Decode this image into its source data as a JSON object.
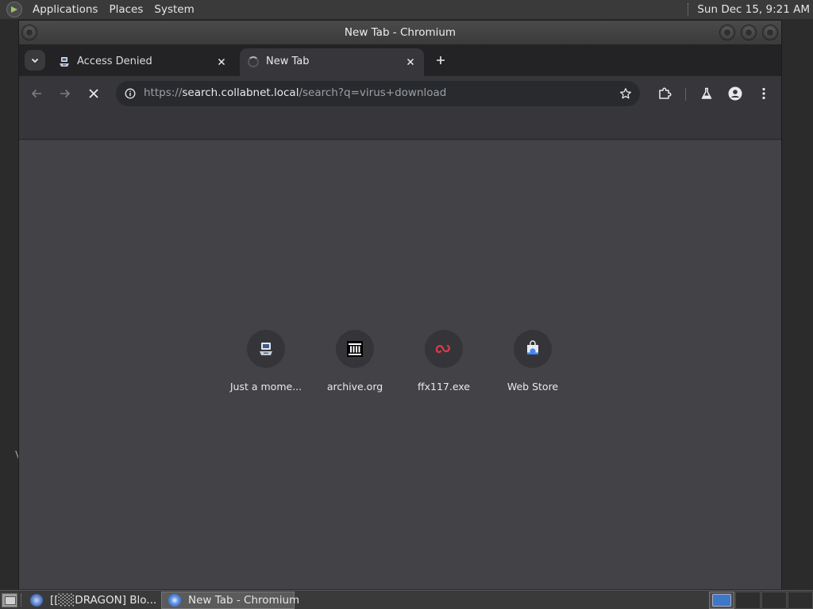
{
  "top_panel": {
    "menus": [
      "Applications",
      "Places",
      "System"
    ],
    "clock": "Sun Dec 15,  9:21 AM"
  },
  "desktop": {
    "edge_glyph": "V"
  },
  "window": {
    "title": "New Tab - Chromium"
  },
  "tabs": [
    {
      "title": "Access Denied",
      "state": "inactive",
      "icon": "site-favicon"
    },
    {
      "title": "New Tab",
      "state": "active-loading",
      "icon": "loading-spinner-icon"
    }
  ],
  "toolbar": {
    "url_scheme": "https://",
    "url_host": "search.collabnet.local",
    "url_path": "/search?q=virus+download"
  },
  "shortcuts": [
    {
      "label": "Just a mome...",
      "icon": "computer-icon"
    },
    {
      "label": "archive.org",
      "icon": "archive-icon"
    },
    {
      "label": "ffx117.exe",
      "icon": "red-link-icon"
    },
    {
      "label": "Web Store",
      "icon": "web-store-icon"
    }
  ],
  "taskbar": {
    "items": [
      {
        "label": "[[░░DRAGON] Blo...",
        "active": false
      },
      {
        "label": "New Tab - Chromium",
        "active": true
      }
    ]
  },
  "colors": {
    "content_background": "#424247",
    "tab_strip": "#232326",
    "accent": "#8ab4f8"
  }
}
